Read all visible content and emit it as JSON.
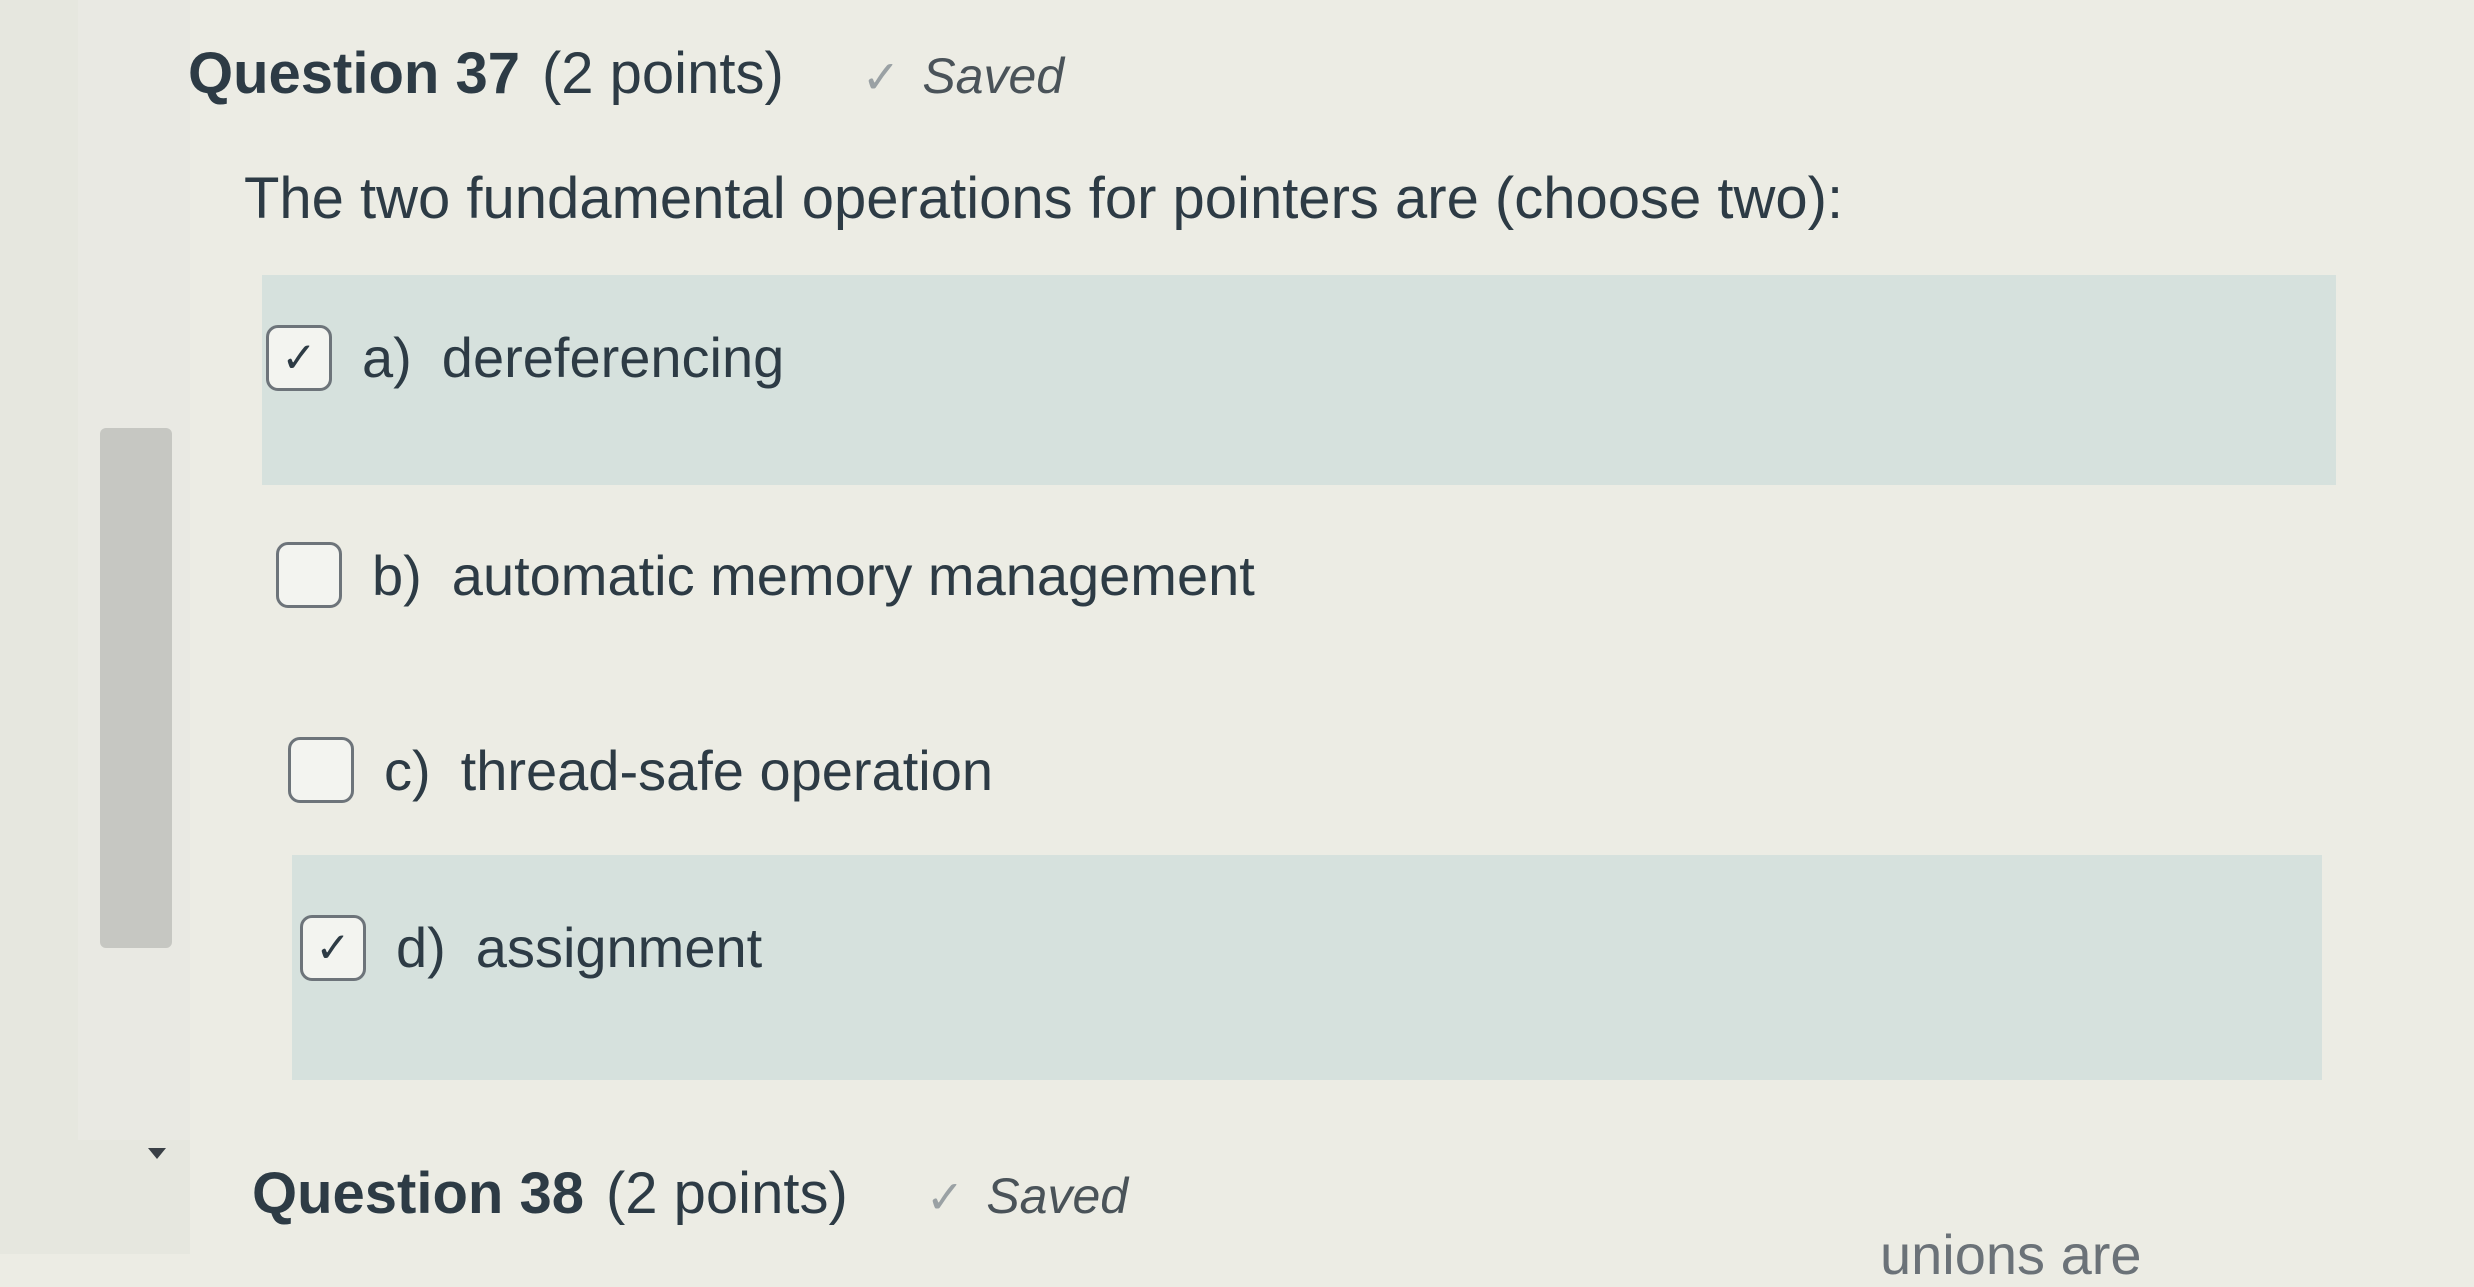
{
  "questions": [
    {
      "title": "Question 37",
      "points": "(2 points)",
      "status": "Saved",
      "prompt": "The two fundamental operations for pointers are (choose two):",
      "options": [
        {
          "letter": "a)",
          "text": "dereferencing",
          "checked": true
        },
        {
          "letter": "b)",
          "text": "automatic memory management",
          "checked": false
        },
        {
          "letter": "c)",
          "text": "thread-safe operation",
          "checked": false
        },
        {
          "letter": "d)",
          "text": "assignment",
          "checked": true
        }
      ]
    },
    {
      "title": "Question 38",
      "points": "(2 points)",
      "status": "Saved",
      "prompt_partial": "unions are"
    }
  ],
  "icons": {
    "saved": "checkmark-icon",
    "checkbox_checked": "checkmark-icon",
    "scroll_down": "caret-down-icon"
  },
  "colors": {
    "selected_background": "#d6e1dd",
    "text": "#2d3b45",
    "page_background": "#ecece4"
  }
}
